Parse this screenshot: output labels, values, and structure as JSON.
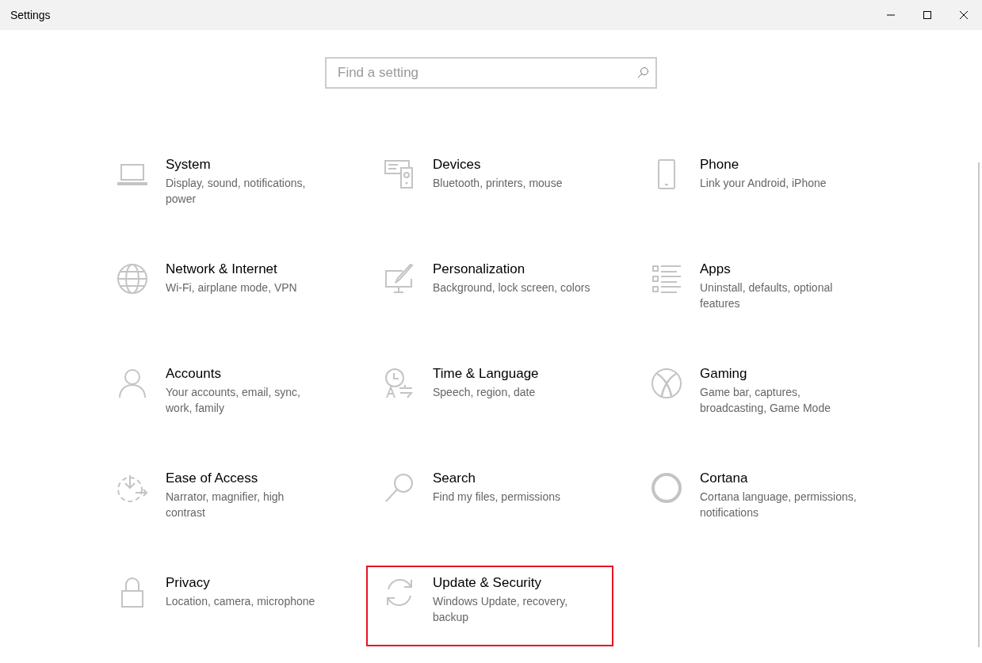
{
  "window": {
    "title": "Settings"
  },
  "search": {
    "placeholder": "Find a setting"
  },
  "categories": [
    {
      "title": "System",
      "description": "Display, sound, notifications, power",
      "highlighted": false
    },
    {
      "title": "Devices",
      "description": "Bluetooth, printers, mouse",
      "highlighted": false
    },
    {
      "title": "Phone",
      "description": "Link your Android, iPhone",
      "highlighted": false
    },
    {
      "title": "Network & Internet",
      "description": "Wi-Fi, airplane mode, VPN",
      "highlighted": false
    },
    {
      "title": "Personalization",
      "description": "Background, lock screen, colors",
      "highlighted": false
    },
    {
      "title": "Apps",
      "description": "Uninstall, defaults, optional features",
      "highlighted": false
    },
    {
      "title": "Accounts",
      "description": "Your accounts, email, sync, work, family",
      "highlighted": false
    },
    {
      "title": "Time & Language",
      "description": "Speech, region, date",
      "highlighted": false
    },
    {
      "title": "Gaming",
      "description": "Game bar, captures, broadcasting, Game Mode",
      "highlighted": false
    },
    {
      "title": "Ease of Access",
      "description": "Narrator, magnifier, high contrast",
      "highlighted": false
    },
    {
      "title": "Search",
      "description": "Find my files, permissions",
      "highlighted": false
    },
    {
      "title": "Cortana",
      "description": "Cortana language, permissions, notifications",
      "highlighted": false
    },
    {
      "title": "Privacy",
      "description": "Location, camera, microphone",
      "highlighted": false
    },
    {
      "title": "Update & Security",
      "description": "Windows Update, recovery, backup",
      "highlighted": true
    }
  ]
}
